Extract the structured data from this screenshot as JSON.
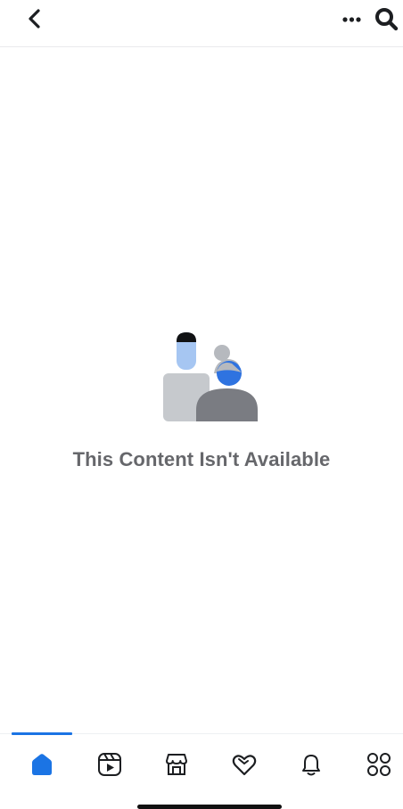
{
  "header": {
    "back_icon": "chevron-left-icon",
    "more_icon": "ellipsis-icon",
    "search_icon": "search-icon"
  },
  "content": {
    "message": "This Content Isn't Available",
    "illustration_icon": "unavailable-people-illustration"
  },
  "tabbar": {
    "active_tab": "home",
    "tabs": [
      {
        "id": "home",
        "icon": "home-icon"
      },
      {
        "id": "video",
        "icon": "video-icon"
      },
      {
        "id": "marketplace",
        "icon": "marketplace-icon"
      },
      {
        "id": "dating",
        "icon": "dating-heart-icon"
      },
      {
        "id": "notifications",
        "icon": "bell-icon"
      },
      {
        "id": "menu",
        "icon": "menu-grid-icon"
      }
    ]
  },
  "colors": {
    "accent": "#1b74e4",
    "text_muted": "#66676b",
    "icon": "#1c1e21"
  }
}
